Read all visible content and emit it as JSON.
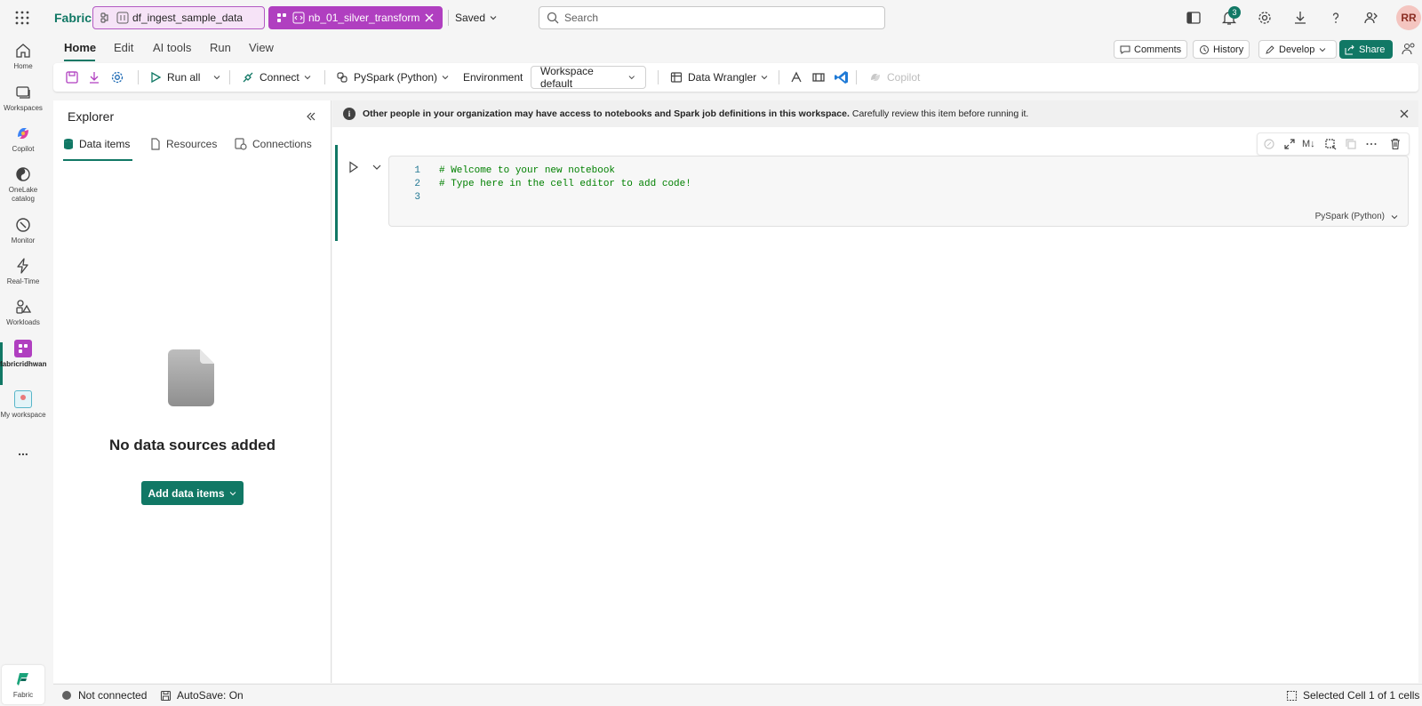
{
  "app": {
    "name": "Fabric"
  },
  "tabs": [
    {
      "label": "df_ingest_sample_data",
      "icon": "dataflow-icon"
    },
    {
      "label": "nb_01_silver_transform",
      "icon": "notebook-icon"
    }
  ],
  "save_status": "Saved",
  "search": {
    "placeholder": "Search"
  },
  "notifications": {
    "count": "3"
  },
  "user": {
    "initials": "RR"
  },
  "rail": [
    {
      "label": "Home",
      "icon": "home-icon"
    },
    {
      "label": "Workspaces",
      "icon": "workspaces-icon"
    },
    {
      "label": "Copilot",
      "icon": "copilot-icon"
    },
    {
      "label": "OneLake catalog",
      "icon": "onelake-icon"
    },
    {
      "label": "Monitor",
      "icon": "monitor-icon"
    },
    {
      "label": "Real-Time",
      "icon": "lightning-icon"
    },
    {
      "label": "Workloads",
      "icon": "workloads-icon"
    },
    {
      "label": "fabricridhwan",
      "icon": "workspace-icon"
    },
    {
      "label": "My workspace",
      "icon": "my-workspace-icon"
    },
    {
      "label": "...",
      "icon": "more-icon"
    },
    {
      "label": "Fabric",
      "icon": "fabric-logo-icon"
    }
  ],
  "menu": {
    "items": [
      "Home",
      "Edit",
      "AI tools",
      "Run",
      "View"
    ],
    "active": "Home",
    "comments": "Comments",
    "history": "History",
    "develop": "Develop",
    "share": "Share"
  },
  "toolbar": {
    "run_all": "Run all",
    "connect": "Connect",
    "language": "PySpark (Python)",
    "environment_label": "Environment",
    "environment_value": "Workspace default",
    "data_wrangler": "Data Wrangler",
    "copilot": "Copilot"
  },
  "explorer": {
    "title": "Explorer",
    "tabs": [
      "Data items",
      "Resources",
      "Connections"
    ],
    "empty_text": "No data sources added",
    "add_button": "Add data items"
  },
  "banner": {
    "bold": "Other people in your organization may have access to notebooks and Spark job definitions in this workspace.",
    "text": "Carefully review this item before running it."
  },
  "cell": {
    "lines": [
      {
        "num": "1",
        "text": "# Welcome to your new notebook"
      },
      {
        "num": "2",
        "text": "# Type here in the cell editor to add code!"
      },
      {
        "num": "3",
        "text": ""
      }
    ],
    "language": "PySpark (Python)",
    "toolbar_md": "M↓"
  },
  "status": {
    "connection": "Not connected",
    "autosave": "AutoSave: On",
    "selection": "Selected Cell 1 of 1 cells"
  },
  "colors": {
    "accent": "#117865",
    "notebook_tab": "#b03fc0",
    "dataflow_tab_bg": "#f6e3f7"
  }
}
